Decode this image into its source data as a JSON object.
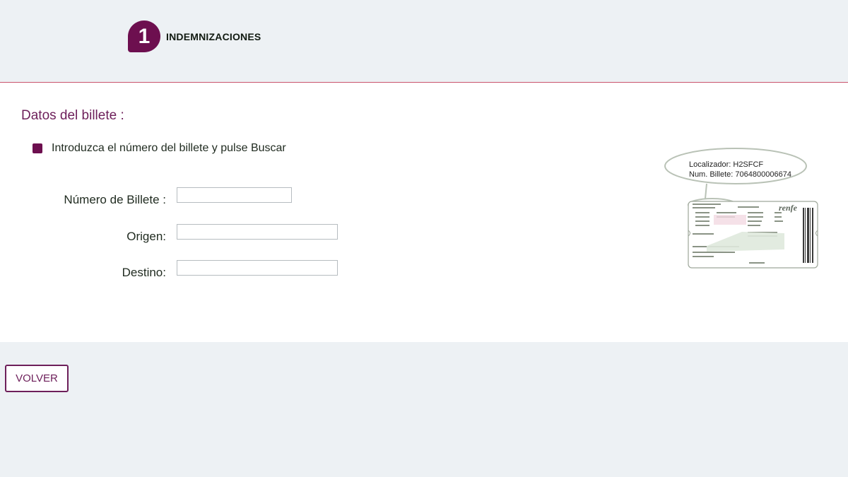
{
  "header": {
    "step_number": "1",
    "step_title": "INDEMNIZACIONES"
  },
  "form": {
    "section_title": "Datos del billete :",
    "instruction": "Introduzca el número del billete y pulse Buscar",
    "fields": {
      "ticket_number": {
        "label": "Número de Billete :",
        "value": ""
      },
      "origin": {
        "label": "Origen:",
        "value": ""
      },
      "destination": {
        "label": "Destino:",
        "value": ""
      }
    }
  },
  "ticket_example": {
    "locator": "Localizador: H2SFCF",
    "ticket_number": "Num. Billete: 7064800006674",
    "brand": "renfe"
  },
  "footer": {
    "back_label": "VOLVER"
  },
  "colors": {
    "accent": "#6d0f4f",
    "divider": "#c9536d",
    "background": "#edf1f4"
  }
}
